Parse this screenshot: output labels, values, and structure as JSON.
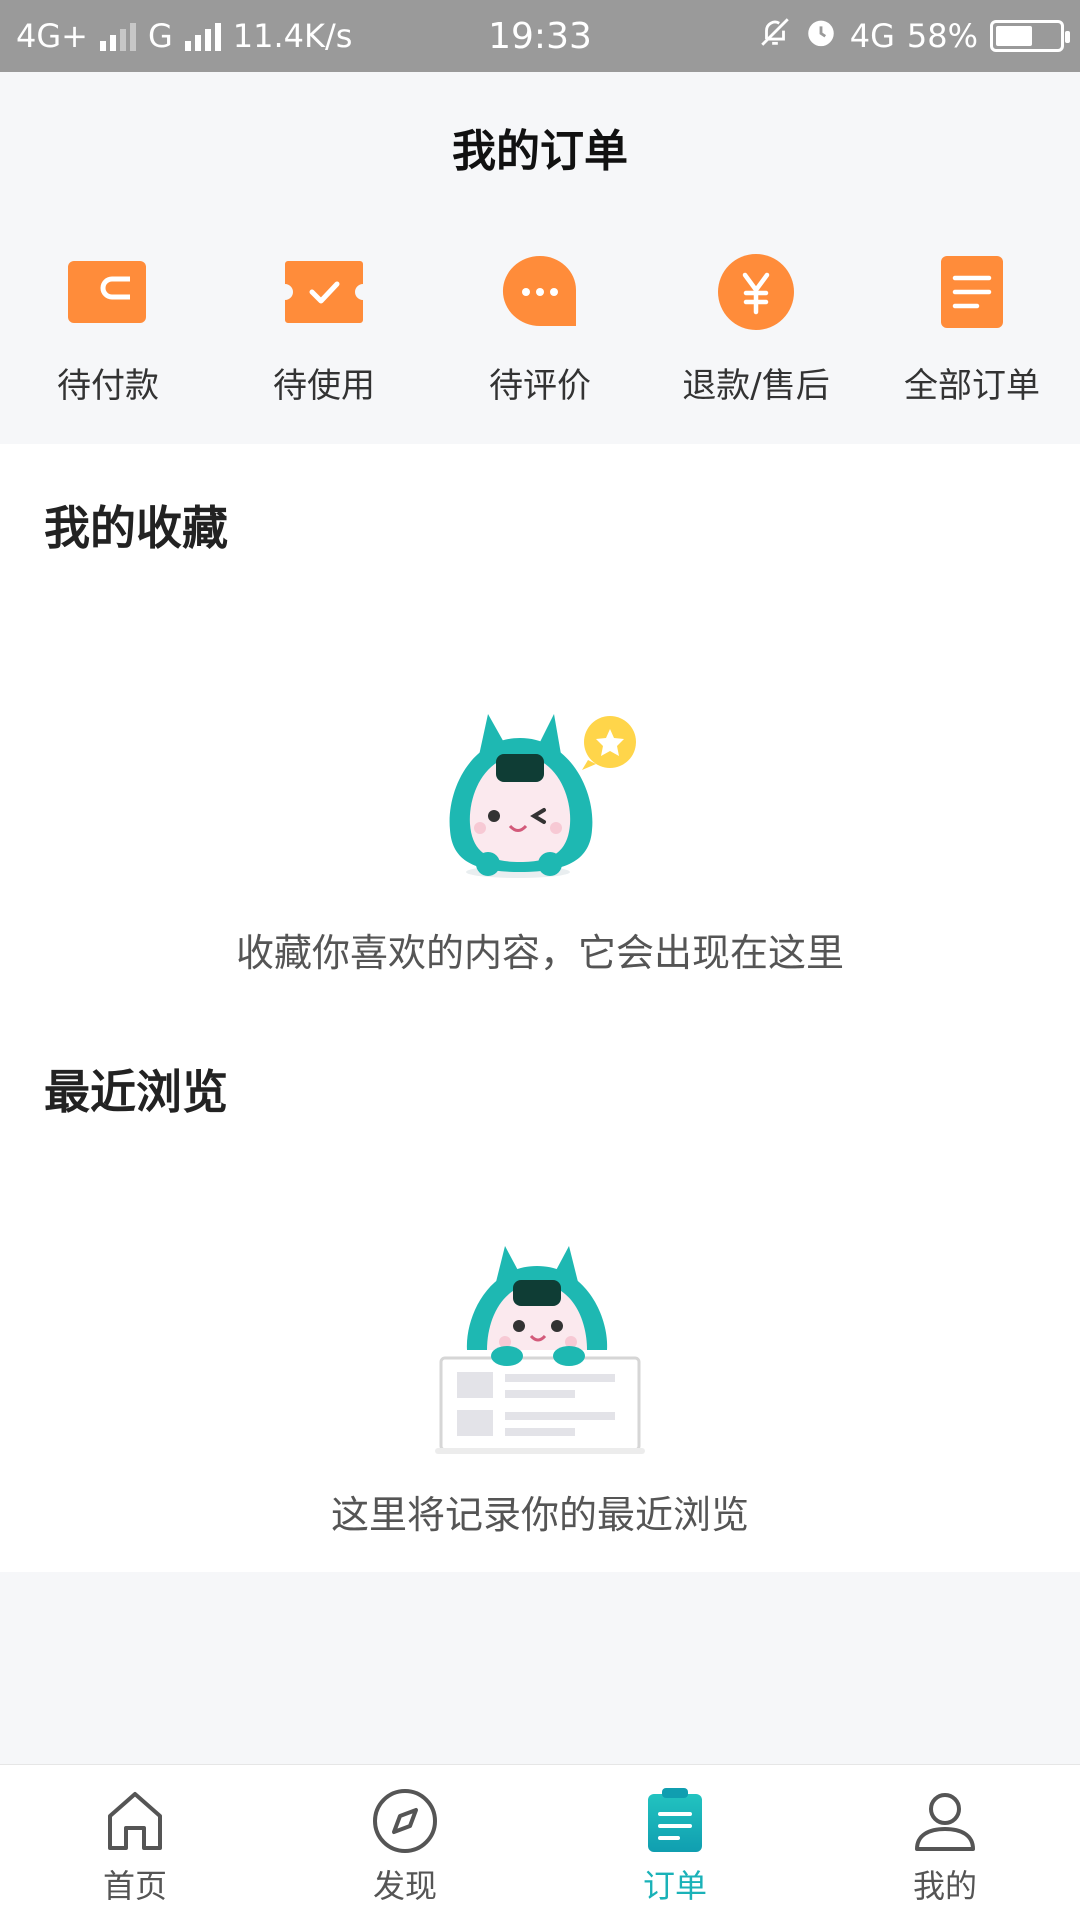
{
  "status_bar": {
    "network1": "4G+",
    "network2": "G",
    "speed": "11.4K/s",
    "time": "19:33",
    "network3": "4G",
    "battery_percent": "58%",
    "battery_level": 0.58
  },
  "header": {
    "title": "我的订单"
  },
  "orders": {
    "accent_color": "#ff8c3a",
    "items": [
      {
        "label": "待付款",
        "icon": "wallet-icon"
      },
      {
        "label": "待使用",
        "icon": "ticket-check-icon"
      },
      {
        "label": "待评价",
        "icon": "chat-bubble-icon"
      },
      {
        "label": "退款/售后",
        "icon": "yuan-refund-icon"
      },
      {
        "label": "全部订单",
        "icon": "list-document-icon"
      }
    ]
  },
  "favorites": {
    "title": "我的收藏",
    "empty_text": "收藏你喜欢的内容，它会出现在这里"
  },
  "recent": {
    "title": "最近浏览",
    "empty_text": "这里将记录你的最近浏览"
  },
  "bottom_nav": {
    "active_color": "#1ab2b8",
    "items": [
      {
        "label": "首页",
        "icon": "home-icon",
        "active": false
      },
      {
        "label": "发现",
        "icon": "compass-icon",
        "active": false
      },
      {
        "label": "订单",
        "icon": "order-icon",
        "active": true
      },
      {
        "label": "我的",
        "icon": "profile-icon",
        "active": false
      }
    ]
  }
}
